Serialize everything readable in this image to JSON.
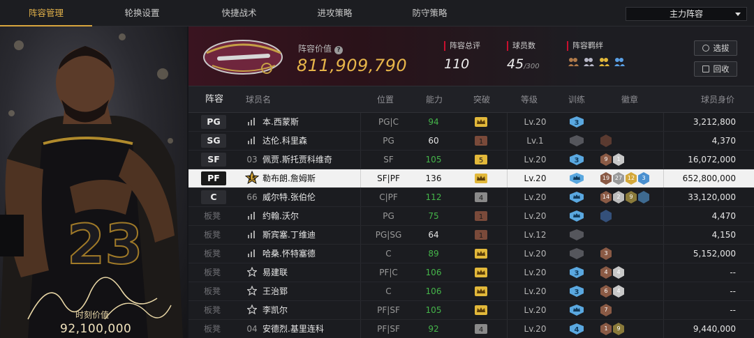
{
  "nav": {
    "tabs": [
      "阵容管理",
      "轮换设置",
      "快捷战术",
      "进攻策略",
      "防守策略"
    ],
    "active_tab": 0,
    "lineup_select": "主力阵容"
  },
  "card": {
    "value_label": "时刻价值",
    "value": "92,100,000",
    "jersey": "23"
  },
  "header": {
    "value_label": "阵容价值",
    "value": "811,909,790",
    "rating_label": "阵容总评",
    "rating": "110",
    "players_label": "球员数",
    "players": "45",
    "players_max": "/300",
    "bond_label": "阵容羁绊",
    "pick_btn": "选拔",
    "recycle_btn": "回收"
  },
  "table": {
    "headers": [
      "阵容",
      "球员名",
      "位置",
      "能力",
      "突破",
      "等级",
      "训练",
      "徽章",
      "球员身价"
    ],
    "rows": [
      {
        "slot": "PG",
        "starter": true,
        "icon": "stat",
        "name": "本.西蒙斯",
        "pos": "PG|C",
        "ability": "94",
        "ability_color": "#45b54a",
        "breakthrough": "crown",
        "level": "Lv.20",
        "training": "3",
        "badges": [],
        "price": "3,212,800"
      },
      {
        "slot": "SG",
        "starter": true,
        "icon": "stat",
        "name": "达伦.科里森",
        "pos": "PG",
        "ability": "60",
        "ability_color": "#e6e6e6",
        "breakthrough": "1",
        "level": "Lv.1",
        "training": "0",
        "badges": [
          {
            "t": "",
            "c": "#5a3a30"
          }
        ],
        "price": "4,370"
      },
      {
        "slot": "SF",
        "starter": true,
        "icon": "03",
        "name": "佩贾.斯托贾科维奇",
        "pos": "SF",
        "ability": "105",
        "ability_color": "#45b54a",
        "breakthrough": "5",
        "level": "Lv.20",
        "training": "3",
        "badges": [
          {
            "t": "9",
            "c": "#8a5a45"
          },
          {
            "t": "1",
            "c": "#c8c8c8"
          }
        ],
        "price": "16,072,000"
      },
      {
        "slot": "PF",
        "starter": true,
        "icon": "15",
        "name": "勒布朗.詹姆斯",
        "pos": "SF|PF",
        "ability": "136",
        "ability_color": "#111111",
        "breakthrough": "crown",
        "level": "Lv.20",
        "training": "crown",
        "badges": [
          {
            "t": "19",
            "c": "#8a5a45"
          },
          {
            "t": "27",
            "c": "#9a9a9a"
          },
          {
            "t": "12",
            "c": "#d4a83a"
          },
          {
            "t": "3",
            "c": "#4a90d0"
          }
        ],
        "price": "652,800,000",
        "highlight": true
      },
      {
        "slot": "C",
        "starter": true,
        "icon": "66",
        "name": "威尔特.张伯伦",
        "pos": "C|PF",
        "ability": "112",
        "ability_color": "#45b54a",
        "breakthrough": "4",
        "level": "Lv.20",
        "training": "crown",
        "badges": [
          {
            "t": "14",
            "c": "#8a5a45"
          },
          {
            "t": "2",
            "c": "#bdbdbd"
          },
          {
            "t": "9",
            "c": "#8a7a3a"
          },
          {
            "t": "",
            "c": "#3e6a90"
          }
        ],
        "price": "33,120,000"
      },
      {
        "slot": "板凳",
        "starter": false,
        "icon": "stat",
        "name": "约翰.沃尔",
        "pos": "PG",
        "ability": "75",
        "ability_color": "#45b54a",
        "breakthrough": "1",
        "level": "Lv.20",
        "training": "crown",
        "badges": [
          {
            "t": "",
            "c": "#34507a"
          }
        ],
        "price": "4,470"
      },
      {
        "slot": "板凳",
        "starter": false,
        "icon": "stat",
        "name": "斯宾塞.丁维迪",
        "pos": "PG|SG",
        "ability": "64",
        "ability_color": "#e6e6e6",
        "breakthrough": "1",
        "level": "Lv.12",
        "training": "0",
        "badges": [],
        "price": "4,150"
      },
      {
        "slot": "板凳",
        "starter": false,
        "icon": "stat",
        "name": "哈桑.怀特塞德",
        "pos": "C",
        "ability": "89",
        "ability_color": "#45b54a",
        "breakthrough": "crown",
        "level": "Lv.20",
        "training": "0",
        "badges": [
          {
            "t": "3",
            "c": "#8a5a45"
          }
        ],
        "price": "5,152,000"
      },
      {
        "slot": "板凳",
        "starter": false,
        "icon": "star",
        "name": "易建联",
        "pos": "PF|C",
        "ability": "106",
        "ability_color": "#45b54a",
        "breakthrough": "crown",
        "level": "Lv.20",
        "training": "3",
        "badges": [
          {
            "t": "4",
            "c": "#8a5a45"
          },
          {
            "t": "4",
            "c": "#c8c8c8"
          }
        ],
        "price": "--"
      },
      {
        "slot": "板凳",
        "starter": false,
        "icon": "star",
        "name": "王治郅",
        "pos": "C",
        "ability": "106",
        "ability_color": "#45b54a",
        "breakthrough": "crown",
        "level": "Lv.20",
        "training": "3",
        "badges": [
          {
            "t": "6",
            "c": "#8a5a45"
          },
          {
            "t": "4",
            "c": "#c8c8c8"
          }
        ],
        "price": "--"
      },
      {
        "slot": "板凳",
        "starter": false,
        "icon": "star",
        "name": "李凯尔",
        "pos": "PF|SF",
        "ability": "105",
        "ability_color": "#45b54a",
        "breakthrough": "crown",
        "level": "Lv.20",
        "training": "crown",
        "badges": [
          {
            "t": "7",
            "c": "#8a5a45"
          }
        ],
        "price": "--"
      },
      {
        "slot": "板凳",
        "starter": false,
        "icon": "04",
        "name": "安德烈.基里连科",
        "pos": "PF|SF",
        "ability": "92",
        "ability_color": "#45b54a",
        "breakthrough": "4",
        "level": "Lv.20",
        "training": "4",
        "badges": [
          {
            "t": "1",
            "c": "#8a5a45"
          },
          {
            "t": "9",
            "c": "#8a7a3a"
          }
        ],
        "price": "9,440,000"
      }
    ]
  },
  "colors": {
    "accent_gold": "#e7b54a",
    "green_ability": "#45b54a",
    "team_wine": "#6f263d"
  }
}
